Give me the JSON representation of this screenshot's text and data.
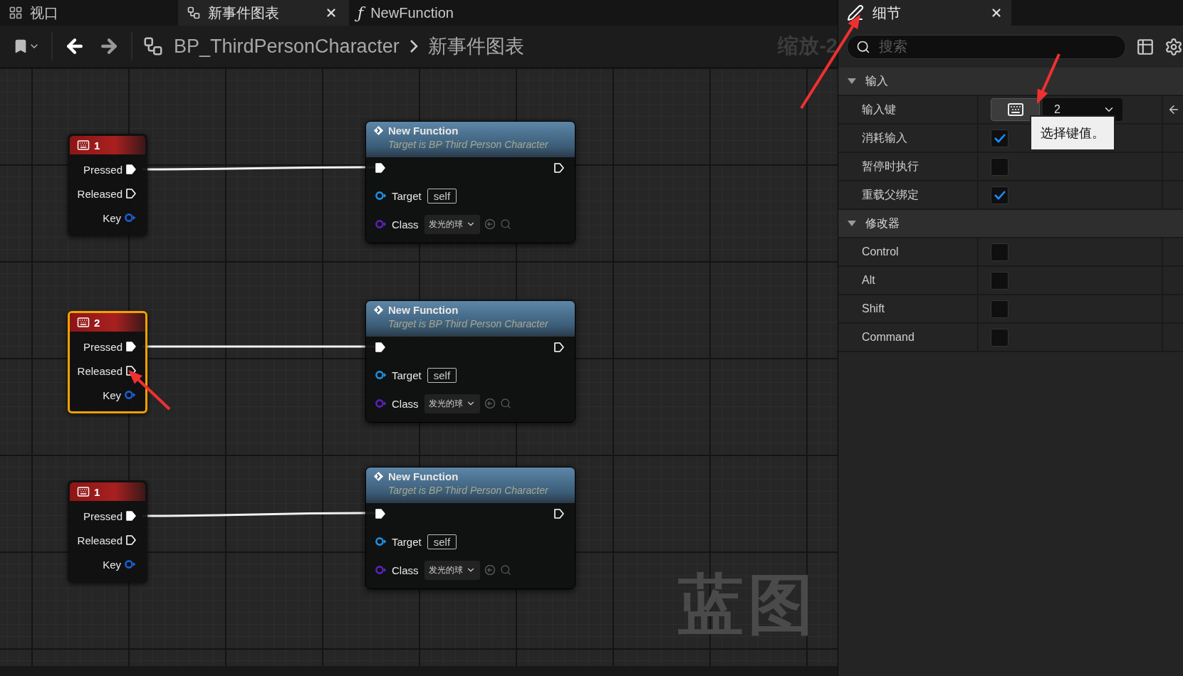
{
  "tabs": [
    {
      "kind": "viewport",
      "label": "视口",
      "selected": false
    },
    {
      "kind": "graph",
      "label": "新事件图表",
      "selected": true
    },
    {
      "kind": "function",
      "glyph": "ƒ",
      "label": "NewFunction",
      "selected": false
    }
  ],
  "toolbar": {
    "breadcrumb": [
      "BP_ThirdPersonCharacter",
      "新事件图表"
    ],
    "zoom": "缩放-2"
  },
  "graph": {
    "watermark": "蓝图",
    "events": [
      {
        "key": "1",
        "selected": false,
        "pins": [
          {
            "kind": "exec",
            "label": "Pressed",
            "connected": true
          },
          {
            "kind": "exec",
            "label": "Released",
            "connected": false
          },
          {
            "kind": "data",
            "label": "Key",
            "color": "#1a5fd0",
            "connected": false
          }
        ]
      },
      {
        "key": "2",
        "selected": true,
        "pins": [
          {
            "kind": "exec",
            "label": "Pressed",
            "connected": true
          },
          {
            "kind": "exec",
            "label": "Released",
            "connected": false
          },
          {
            "kind": "data",
            "label": "Key",
            "color": "#1a5fd0",
            "connected": false
          }
        ]
      },
      {
        "key": "1",
        "selected": false,
        "pins": [
          {
            "kind": "exec",
            "label": "Pressed",
            "connected": true
          },
          {
            "kind": "exec",
            "label": "Released",
            "connected": false
          },
          {
            "kind": "data",
            "label": "Key",
            "color": "#1a5fd0",
            "connected": false
          }
        ]
      }
    ],
    "functions": [
      {
        "title": "New Function",
        "subtitle": "Target is BP Third Person Character",
        "exec_in": true,
        "exec_out": false,
        "target": {
          "label": "Target",
          "value": "self",
          "color": "#1c8fe0"
        },
        "class": {
          "label": "Class",
          "value": "发光的球",
          "color": "#5a22b8"
        }
      },
      {
        "title": "New Function",
        "subtitle": "Target is BP Third Person Character",
        "exec_in": true,
        "exec_out": false,
        "target": {
          "label": "Target",
          "value": "self",
          "color": "#1c8fe0"
        },
        "class": {
          "label": "Class",
          "value": "发光的球",
          "color": "#5a22b8"
        }
      },
      {
        "title": "New Function",
        "subtitle": "Target is BP Third Person Character",
        "exec_in": true,
        "exec_out": false,
        "target": {
          "label": "Target",
          "value": "self",
          "color": "#1c8fe0"
        },
        "class": {
          "label": "Class",
          "value": "发光的球",
          "color": "#5a22b8"
        }
      }
    ]
  },
  "details": {
    "tab": "细节",
    "search_placeholder": "搜索",
    "sections": [
      {
        "title": "输入",
        "expanded": true,
        "rows": [
          {
            "kind": "key",
            "label": "输入键",
            "value": "2"
          },
          {
            "kind": "checkbox",
            "label": "消耗输入",
            "checked": true
          },
          {
            "kind": "checkbox",
            "label": "暂停时执行",
            "checked": false
          },
          {
            "kind": "checkbox",
            "label": "重载父绑定",
            "checked": true
          }
        ]
      },
      {
        "title": "修改器",
        "expanded": true,
        "rows": [
          {
            "kind": "checkbox",
            "label": "Control",
            "checked": false
          },
          {
            "kind": "checkbox",
            "label": "Alt",
            "checked": false
          },
          {
            "kind": "checkbox",
            "label": "Shift",
            "checked": false
          },
          {
            "kind": "checkbox",
            "label": "Command",
            "checked": false
          }
        ]
      }
    ],
    "tooltip": "选择键值。"
  }
}
